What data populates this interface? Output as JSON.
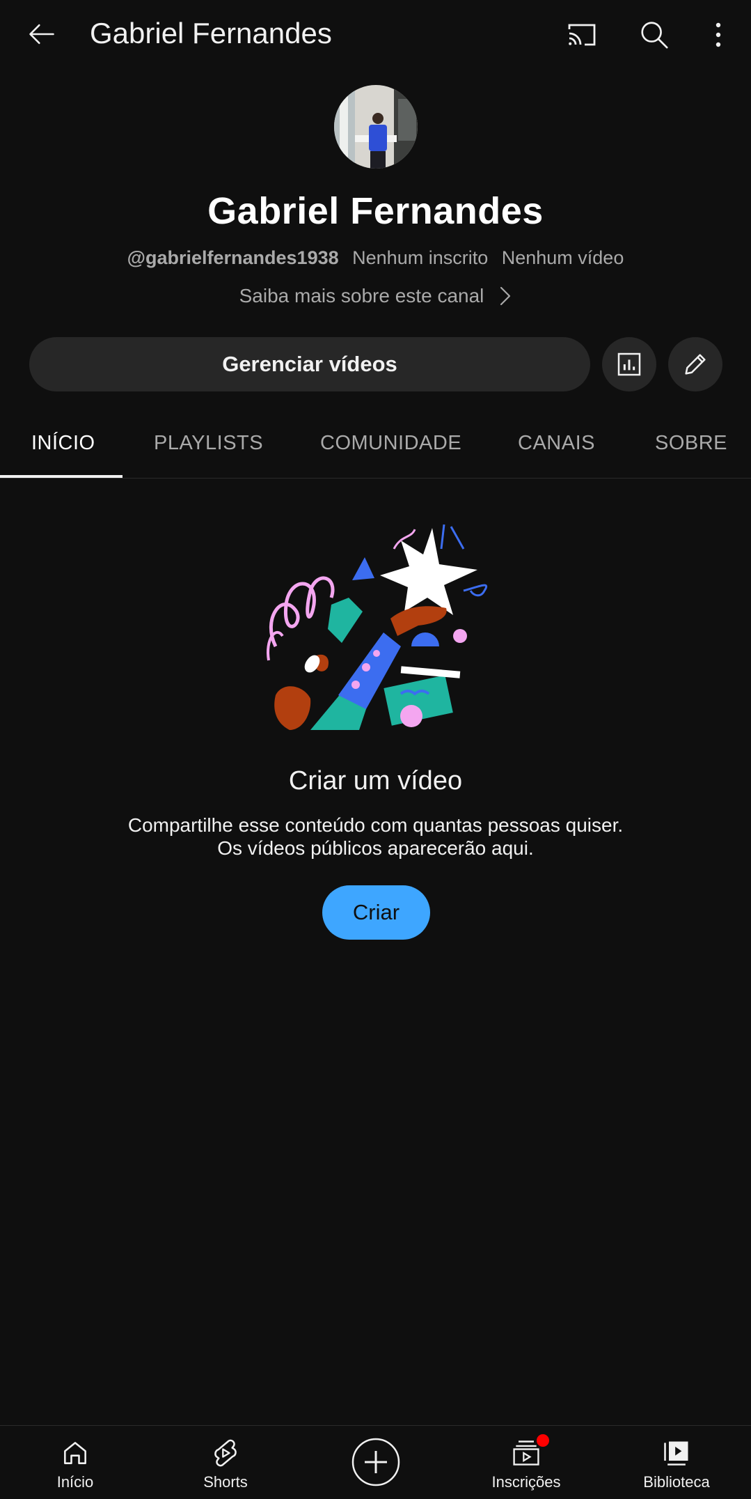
{
  "header": {
    "title": "Gabriel Fernandes",
    "icons": [
      "back-arrow-icon",
      "cast-icon",
      "search-icon",
      "more-vert-icon"
    ]
  },
  "channel": {
    "name": "Gabriel Fernandes",
    "handle": "@gabrielfernandes1938",
    "subscribers": "Nenhum inscrito",
    "videos": "Nenhum vídeo",
    "about_link": "Saiba mais sobre este canal"
  },
  "actions": {
    "manage_label": "Gerenciar vídeos",
    "icons": [
      "analytics-icon",
      "edit-pencil-icon"
    ]
  },
  "tabs": [
    {
      "label": "INÍCIO",
      "active": true
    },
    {
      "label": "PLAYLISTS",
      "active": false
    },
    {
      "label": "COMUNIDADE",
      "active": false
    },
    {
      "label": "CANAIS",
      "active": false
    },
    {
      "label": "SOBRE",
      "active": false
    }
  ],
  "empty_state": {
    "title": "Criar um vídeo",
    "line1": "Compartilhe esse conteúdo com quantas pessoas quiser.",
    "line2": "Os vídeos públicos aparecerão aqui.",
    "button": "Criar"
  },
  "bottom_nav": [
    {
      "label": "Início",
      "icon": "home-icon"
    },
    {
      "label": "Shorts",
      "icon": "shorts-icon"
    },
    {
      "label": "",
      "icon": "create-plus-icon"
    },
    {
      "label": "Inscrições",
      "icon": "subscriptions-icon",
      "notification_dot": true
    },
    {
      "label": "Biblioteca",
      "icon": "library-icon"
    }
  ],
  "colors": {
    "background": "#0f0f0f",
    "button_bg": "#272727",
    "accent_blue": "#3ea6ff",
    "notification_red": "#ff0000"
  }
}
